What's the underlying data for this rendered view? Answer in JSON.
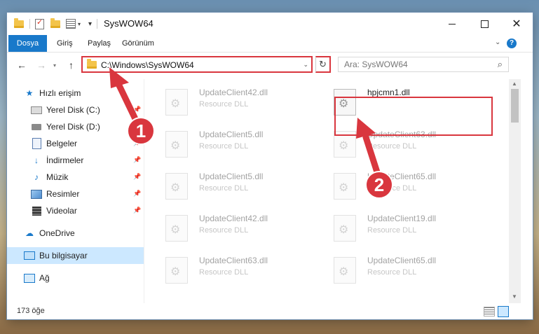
{
  "window": {
    "title": "SysWOW64",
    "controls": {
      "minimize": "—",
      "maximize": "",
      "close": "✕"
    }
  },
  "quick_access_toolbar": {
    "customize": "▾"
  },
  "ribbon": {
    "tabs": [
      {
        "label": "Dosya",
        "active": true
      },
      {
        "label": "Giriş"
      },
      {
        "label": "Paylaş"
      },
      {
        "label": "Görünüm"
      }
    ],
    "expand_icon": "chevron-down-icon",
    "help_label": "?"
  },
  "navigation": {
    "back": "←",
    "forward": "→",
    "recent": "▾",
    "up": "↑",
    "address": "C:\\Windows\\SysWOW64",
    "address_dropdown": "⌄",
    "refresh": "↻",
    "search": {
      "placeholder": "Ara: SysWOW64",
      "icon": "🔍"
    }
  },
  "sidebar": {
    "items": [
      {
        "label": "Hızlı erişim",
        "icon": "star-icon"
      },
      {
        "label": "Yerel Disk (C:)",
        "icon": "drive-icon",
        "pinned": true
      },
      {
        "label": "Yerel Disk (D:)",
        "icon": "drive-icon"
      },
      {
        "label": "Belgeler",
        "icon": "documents-icon",
        "pinned": true
      },
      {
        "label": "İndirmeler",
        "icon": "downloads-icon",
        "pinned": true
      },
      {
        "label": "Müzik",
        "icon": "music-icon",
        "pinned": true
      },
      {
        "label": "Resimler",
        "icon": "pictures-icon",
        "pinned": true
      },
      {
        "label": "Videolar",
        "icon": "videos-icon",
        "pinned": true
      },
      {
        "label": "OneDrive",
        "icon": "cloud-icon"
      },
      {
        "label": "Bu bilgisayar",
        "icon": "computer-icon",
        "selected": true
      },
      {
        "label": "Ağ",
        "icon": "network-icon"
      }
    ]
  },
  "files": [
    {
      "name": "UpdateClient42.dll",
      "type": "Resource DLL"
    },
    {
      "name": "hpjcmn1.dll",
      "type": ""
    },
    {
      "name": "UpdateClient5.dll",
      "type": "Resource DLL"
    },
    {
      "name": "UpdateClient63.dll",
      "type": "Resource DLL"
    },
    {
      "name": "UpdateClient5.dll",
      "type": "Resource DLL"
    },
    {
      "name": "UpdateClient65.dll",
      "type": "Resource DLL"
    },
    {
      "name": "UpdateClient42.dll",
      "type": "Resource DLL"
    },
    {
      "name": "UpdateClient19.dll",
      "type": "Resource DLL"
    },
    {
      "name": "UpdateClient63.dll",
      "type": "Resource DLL"
    },
    {
      "name": "UpdateClient65.dll",
      "type": "Resource DLL"
    }
  ],
  "statusbar": {
    "item_count": "173 öğe"
  },
  "annotations": {
    "step1": "1",
    "step2": "2",
    "color": "#d9363e"
  }
}
